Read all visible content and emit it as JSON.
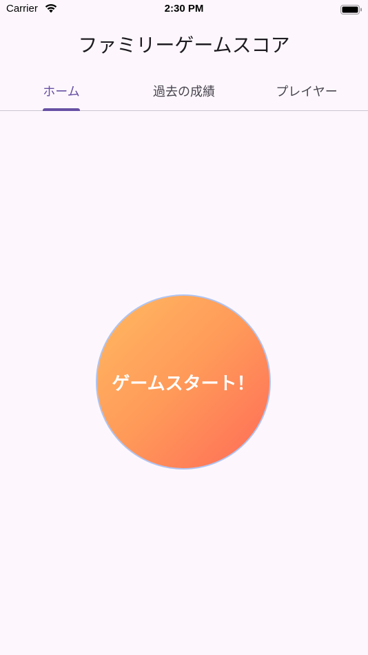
{
  "status_bar": {
    "carrier": "Carrier",
    "time": "2:30 PM",
    "icons": [
      "wifi-icon",
      "battery-icon"
    ]
  },
  "app": {
    "title": "ファミリーゲームスコア"
  },
  "tabs": [
    {
      "label": "ホーム",
      "active": true
    },
    {
      "label": "過去の成績",
      "active": false
    },
    {
      "label": "プレイヤー",
      "active": false
    }
  ],
  "main": {
    "start_button_label": "ゲームスタート！"
  },
  "colors": {
    "accent": "#6750a4",
    "background": "#fdf7fd",
    "button_gradient_start": "#ffb961",
    "button_gradient_end": "#ff6b58",
    "button_border": "#b0c4f2"
  }
}
